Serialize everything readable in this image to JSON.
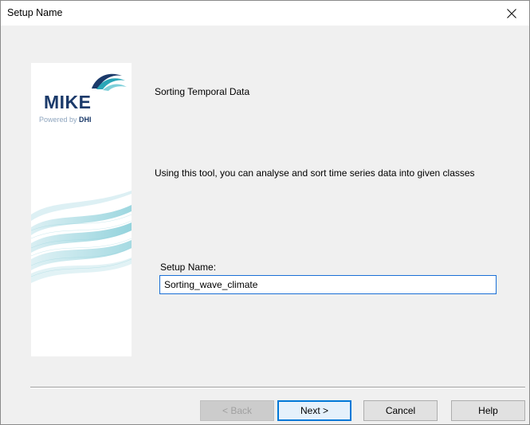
{
  "window": {
    "title": "Setup Name"
  },
  "banner": {
    "logo_text": "MIKE",
    "powered_by": "Powered by",
    "powered_brand": "DHI",
    "colors": {
      "logo_dark": "#1b3a6a",
      "wave_teal": "#2aa6b8"
    }
  },
  "intro": {
    "title": "Sorting Temporal Data",
    "description": "Using this tool, you can analyse and sort time series data into given classes"
  },
  "form": {
    "setup_name_label": "Setup Name:",
    "setup_name_value": "Sorting_wave_climate"
  },
  "buttons": {
    "back": "< Back",
    "next": "Next >",
    "cancel": "Cancel",
    "help": "Help"
  },
  "icons": {
    "close": "close-icon",
    "logo_swoosh": "wave-logo-icon"
  }
}
